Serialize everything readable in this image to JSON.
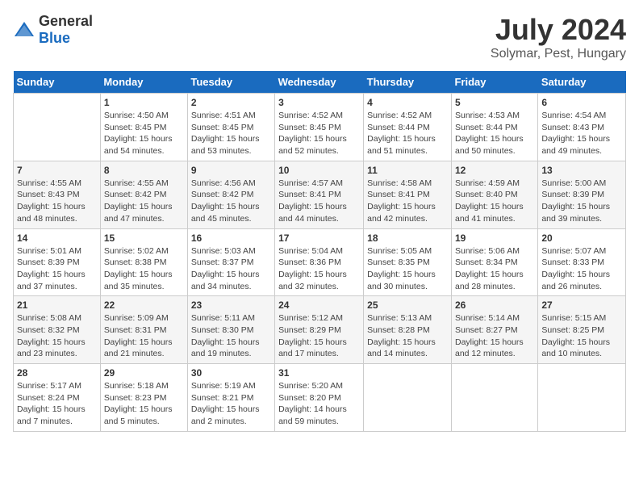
{
  "header": {
    "logo_general": "General",
    "logo_blue": "Blue",
    "title": "July 2024",
    "subtitle": "Solymar, Pest, Hungary"
  },
  "calendar": {
    "days_of_week": [
      "Sunday",
      "Monday",
      "Tuesday",
      "Wednesday",
      "Thursday",
      "Friday",
      "Saturday"
    ],
    "weeks": [
      [
        {
          "day": "",
          "info": ""
        },
        {
          "day": "1",
          "info": "Sunrise: 4:50 AM\nSunset: 8:45 PM\nDaylight: 15 hours\nand 54 minutes."
        },
        {
          "day": "2",
          "info": "Sunrise: 4:51 AM\nSunset: 8:45 PM\nDaylight: 15 hours\nand 53 minutes."
        },
        {
          "day": "3",
          "info": "Sunrise: 4:52 AM\nSunset: 8:45 PM\nDaylight: 15 hours\nand 52 minutes."
        },
        {
          "day": "4",
          "info": "Sunrise: 4:52 AM\nSunset: 8:44 PM\nDaylight: 15 hours\nand 51 minutes."
        },
        {
          "day": "5",
          "info": "Sunrise: 4:53 AM\nSunset: 8:44 PM\nDaylight: 15 hours\nand 50 minutes."
        },
        {
          "day": "6",
          "info": "Sunrise: 4:54 AM\nSunset: 8:43 PM\nDaylight: 15 hours\nand 49 minutes."
        }
      ],
      [
        {
          "day": "7",
          "info": "Sunrise: 4:55 AM\nSunset: 8:43 PM\nDaylight: 15 hours\nand 48 minutes."
        },
        {
          "day": "8",
          "info": "Sunrise: 4:55 AM\nSunset: 8:42 PM\nDaylight: 15 hours\nand 47 minutes."
        },
        {
          "day": "9",
          "info": "Sunrise: 4:56 AM\nSunset: 8:42 PM\nDaylight: 15 hours\nand 45 minutes."
        },
        {
          "day": "10",
          "info": "Sunrise: 4:57 AM\nSunset: 8:41 PM\nDaylight: 15 hours\nand 44 minutes."
        },
        {
          "day": "11",
          "info": "Sunrise: 4:58 AM\nSunset: 8:41 PM\nDaylight: 15 hours\nand 42 minutes."
        },
        {
          "day": "12",
          "info": "Sunrise: 4:59 AM\nSunset: 8:40 PM\nDaylight: 15 hours\nand 41 minutes."
        },
        {
          "day": "13",
          "info": "Sunrise: 5:00 AM\nSunset: 8:39 PM\nDaylight: 15 hours\nand 39 minutes."
        }
      ],
      [
        {
          "day": "14",
          "info": "Sunrise: 5:01 AM\nSunset: 8:39 PM\nDaylight: 15 hours\nand 37 minutes."
        },
        {
          "day": "15",
          "info": "Sunrise: 5:02 AM\nSunset: 8:38 PM\nDaylight: 15 hours\nand 35 minutes."
        },
        {
          "day": "16",
          "info": "Sunrise: 5:03 AM\nSunset: 8:37 PM\nDaylight: 15 hours\nand 34 minutes."
        },
        {
          "day": "17",
          "info": "Sunrise: 5:04 AM\nSunset: 8:36 PM\nDaylight: 15 hours\nand 32 minutes."
        },
        {
          "day": "18",
          "info": "Sunrise: 5:05 AM\nSunset: 8:35 PM\nDaylight: 15 hours\nand 30 minutes."
        },
        {
          "day": "19",
          "info": "Sunrise: 5:06 AM\nSunset: 8:34 PM\nDaylight: 15 hours\nand 28 minutes."
        },
        {
          "day": "20",
          "info": "Sunrise: 5:07 AM\nSunset: 8:33 PM\nDaylight: 15 hours\nand 26 minutes."
        }
      ],
      [
        {
          "day": "21",
          "info": "Sunrise: 5:08 AM\nSunset: 8:32 PM\nDaylight: 15 hours\nand 23 minutes."
        },
        {
          "day": "22",
          "info": "Sunrise: 5:09 AM\nSunset: 8:31 PM\nDaylight: 15 hours\nand 21 minutes."
        },
        {
          "day": "23",
          "info": "Sunrise: 5:11 AM\nSunset: 8:30 PM\nDaylight: 15 hours\nand 19 minutes."
        },
        {
          "day": "24",
          "info": "Sunrise: 5:12 AM\nSunset: 8:29 PM\nDaylight: 15 hours\nand 17 minutes."
        },
        {
          "day": "25",
          "info": "Sunrise: 5:13 AM\nSunset: 8:28 PM\nDaylight: 15 hours\nand 14 minutes."
        },
        {
          "day": "26",
          "info": "Sunrise: 5:14 AM\nSunset: 8:27 PM\nDaylight: 15 hours\nand 12 minutes."
        },
        {
          "day": "27",
          "info": "Sunrise: 5:15 AM\nSunset: 8:25 PM\nDaylight: 15 hours\nand 10 minutes."
        }
      ],
      [
        {
          "day": "28",
          "info": "Sunrise: 5:17 AM\nSunset: 8:24 PM\nDaylight: 15 hours\nand 7 minutes."
        },
        {
          "day": "29",
          "info": "Sunrise: 5:18 AM\nSunset: 8:23 PM\nDaylight: 15 hours\nand 5 minutes."
        },
        {
          "day": "30",
          "info": "Sunrise: 5:19 AM\nSunset: 8:21 PM\nDaylight: 15 hours\nand 2 minutes."
        },
        {
          "day": "31",
          "info": "Sunrise: 5:20 AM\nSunset: 8:20 PM\nDaylight: 14 hours\nand 59 minutes."
        },
        {
          "day": "",
          "info": ""
        },
        {
          "day": "",
          "info": ""
        },
        {
          "day": "",
          "info": ""
        }
      ]
    ]
  }
}
